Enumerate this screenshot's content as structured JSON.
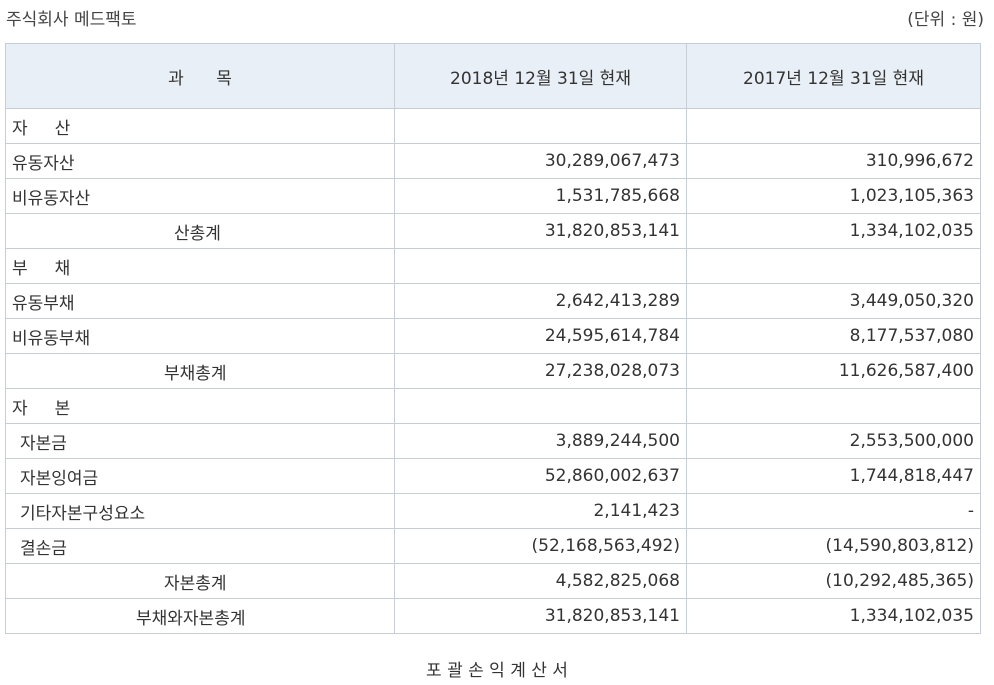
{
  "header": {
    "company": "주식회사 메드팩토",
    "unit": "(단위 : 원)"
  },
  "table": {
    "columns": [
      "과      목",
      "2018년 12월 31일 현재",
      "2017년 12월 31일 현재"
    ],
    "rows": [
      {
        "label": "자     산",
        "v2018": "",
        "v2017": "",
        "style": "lvl0"
      },
      {
        "label": "유동자산",
        "v2018": "30,289,067,473",
        "v2017": "310,996,672",
        "style": "lvl0"
      },
      {
        "label": "비유동자산",
        "v2018": "1,531,785,668",
        "v2017": "1,023,105,363",
        "style": "lvl0"
      },
      {
        "label": "산총계",
        "v2018": "31,820,853,141",
        "v2017": "1,334,102,035",
        "style": "total-a"
      },
      {
        "label": "부     채",
        "v2018": "",
        "v2017": "",
        "style": "lvl0"
      },
      {
        "label": "유동부채",
        "v2018": "2,642,413,289",
        "v2017": "3,449,050,320",
        "style": "lvl0"
      },
      {
        "label": "비유동부채",
        "v2018": "24,595,614,784",
        "v2017": "8,177,537,080",
        "style": "lvl0"
      },
      {
        "label": "부채총계",
        "v2018": "27,238,028,073",
        "v2017": "11,626,587,400",
        "style": "total-b"
      },
      {
        "label": "자     본",
        "v2018": "",
        "v2017": "",
        "style": "lvl0"
      },
      {
        "label": "자본금",
        "v2018": "3,889,244,500",
        "v2017": "2,553,500,000",
        "style": "lvl1"
      },
      {
        "label": "자본잉여금",
        "v2018": "52,860,002,637",
        "v2017": "1,744,818,447",
        "style": "lvl1"
      },
      {
        "label": "기타자본구성요소",
        "v2018": "2,141,423",
        "v2017": "-",
        "style": "lvl1"
      },
      {
        "label": "결손금",
        "v2018": "(52,168,563,492)",
        "v2017": "(14,590,803,812)",
        "style": "lvl1"
      },
      {
        "label": "자본총계",
        "v2018": "4,582,825,068",
        "v2017": "(10,292,485,365)",
        "style": "total-b"
      },
      {
        "label": "부채와자본총계",
        "v2018": "31,820,853,141",
        "v2017": "1,334,102,035",
        "style": "total-c"
      }
    ]
  },
  "footer": {
    "title": "포 괄 손 익 계 산 서"
  }
}
